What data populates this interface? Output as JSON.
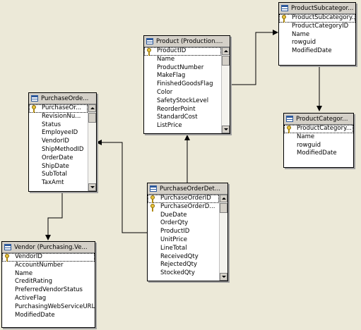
{
  "tables": [
    {
      "name": "purchase-order-header",
      "title": "PurchaseOrde...",
      "scroll": true,
      "rows": [
        {
          "label": "PurchaseOr...",
          "key": true
        },
        {
          "label": "RevisionNu...",
          "key": false
        },
        {
          "label": "Status",
          "key": false
        },
        {
          "label": "EmployeeID",
          "key": false
        },
        {
          "label": "VendorID",
          "key": false
        },
        {
          "label": "ShipMethodID",
          "key": false
        },
        {
          "label": "OrderDate",
          "key": false
        },
        {
          "label": "ShipDate",
          "key": false
        },
        {
          "label": "SubTotal",
          "key": false
        },
        {
          "label": "TaxAmt",
          "key": false
        }
      ]
    },
    {
      "name": "product",
      "title": "Product (Production....",
      "scroll": true,
      "rows": [
        {
          "label": "ProductID",
          "key": true
        },
        {
          "label": "Name",
          "key": false
        },
        {
          "label": "ProductNumber",
          "key": false
        },
        {
          "label": "MakeFlag",
          "key": false
        },
        {
          "label": "FinishedGoodsFlag",
          "key": false
        },
        {
          "label": "Color",
          "key": false
        },
        {
          "label": "SafetyStockLevel",
          "key": false
        },
        {
          "label": "ReorderPoint",
          "key": false
        },
        {
          "label": "StandardCost",
          "key": false
        },
        {
          "label": "ListPrice",
          "key": false
        }
      ]
    },
    {
      "name": "product-subcategory",
      "title": "ProductSubcategor...",
      "scroll": false,
      "rows": [
        {
          "label": "ProductSubcategory...",
          "key": true
        },
        {
          "label": "ProductCategoryID",
          "key": false
        },
        {
          "label": "Name",
          "key": false
        },
        {
          "label": "rowguid",
          "key": false
        },
        {
          "label": "ModifiedDate",
          "key": false
        }
      ]
    },
    {
      "name": "product-category",
      "title": "ProductCategor...",
      "scroll": false,
      "rows": [
        {
          "label": "ProductCategory...",
          "key": true
        },
        {
          "label": "Name",
          "key": false
        },
        {
          "label": "rowguid",
          "key": false
        },
        {
          "label": "ModifiedDate",
          "key": false
        }
      ]
    },
    {
      "name": "purchase-order-detail",
      "title": "PurchaseOrderDet...",
      "scroll": true,
      "rows": [
        {
          "label": "PurchaseOrderID",
          "key": true
        },
        {
          "label": "PurchaseOrderD...",
          "key": true
        },
        {
          "label": "DueDate",
          "key": false
        },
        {
          "label": "OrderQty",
          "key": false
        },
        {
          "label": "ProductID",
          "key": false
        },
        {
          "label": "UnitPrice",
          "key": false
        },
        {
          "label": "LineTotal",
          "key": false
        },
        {
          "label": "ReceivedQty",
          "key": false
        },
        {
          "label": "RejectedQty",
          "key": false
        },
        {
          "label": "StockedQty",
          "key": false
        }
      ]
    },
    {
      "name": "vendor",
      "title": "Vendor (Purchasing.Ve...",
      "scroll": false,
      "rows": [
        {
          "label": "VendorID",
          "key": true
        },
        {
          "label": "AccountNumber",
          "key": false
        },
        {
          "label": "Name",
          "key": false
        },
        {
          "label": "CreditRating",
          "key": false
        },
        {
          "label": "PreferredVendorStatus",
          "key": false
        },
        {
          "label": "ActiveFlag",
          "key": false
        },
        {
          "label": "PurchasingWebServiceURL",
          "key": false
        },
        {
          "label": "ModifiedDate",
          "key": false
        }
      ]
    }
  ]
}
